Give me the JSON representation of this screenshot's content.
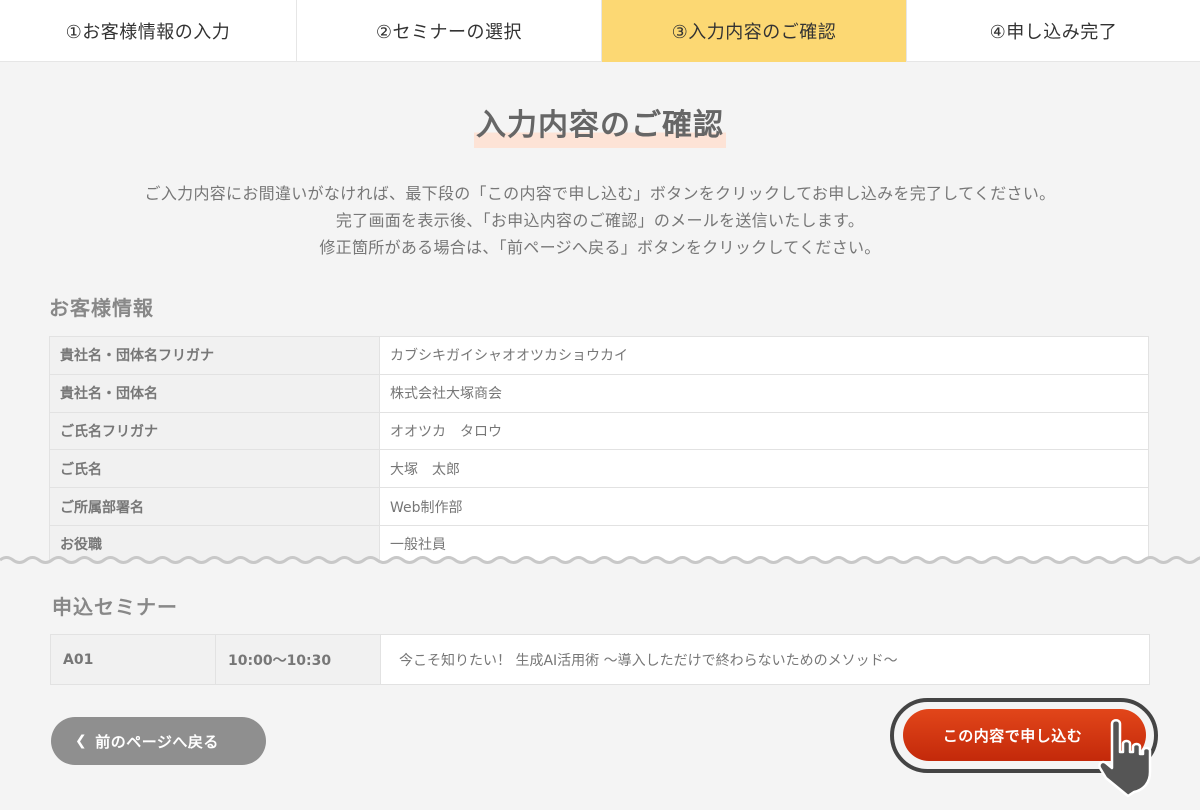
{
  "steps": [
    {
      "label": "①お客様情報の入力"
    },
    {
      "label": "②セミナーの選択"
    },
    {
      "label": "③入力内容のご確認"
    },
    {
      "label": "④申し込み完了"
    }
  ],
  "active_step": 3,
  "title": "入力内容のご確認",
  "intro": [
    "ご入力内容にお間違いがなければ、最下段の「この内容で申し込む」ボタンをクリックしてお申し込みを完了してください。",
    "完了画面を表示後、「お申込内容のご確認」のメールを送信いたします。",
    "修正箇所がある場合は、「前ページへ戻る」ボタンをクリックしてください。"
  ],
  "customer_section": {
    "heading": "お客様情報",
    "rows": [
      {
        "label": "貴社名・団体名フリガナ",
        "value": "カブシキガイシャオオツカショウカイ"
      },
      {
        "label": "貴社名・団体名",
        "value": "株式会社大塚商会"
      },
      {
        "label": "ご氏名フリガナ",
        "value": "オオツカ　タロウ"
      },
      {
        "label": "ご氏名",
        "value": "大塚　太郎"
      },
      {
        "label": "ご所属部署名",
        "value": "Web制作部"
      },
      {
        "label": "お役職",
        "value": "一般社員"
      }
    ]
  },
  "seminar_section": {
    "heading": "申込セミナー",
    "rows": [
      {
        "code": "A01",
        "time": "10:00〜10:30",
        "name": "今こそ知りたい！ 生成AI活用術 〜導入しただけで終わらないためのメソッド〜"
      }
    ]
  },
  "buttons": {
    "back_label": "前のページへ戻る",
    "submit_label": "この内容で申し込む"
  },
  "icons": {
    "back": "chevron-left-icon",
    "pointer": "hand-pointer-icon"
  },
  "colors": {
    "active_step": "#fcd873",
    "submit": "#d6370f",
    "back": "#8f8f8f",
    "title_highlight": "#fde3d6"
  }
}
